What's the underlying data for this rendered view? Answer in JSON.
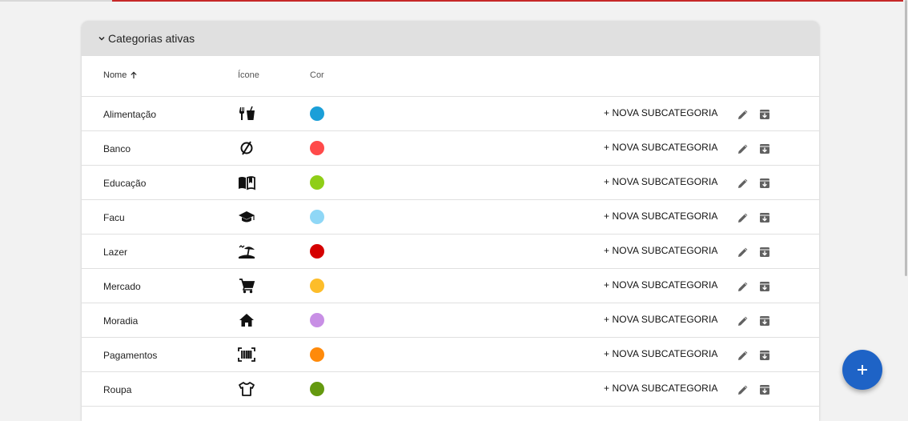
{
  "colors": {
    "accent": "#c62828",
    "fab": "#1e63c6"
  },
  "section": {
    "title": "Categorias ativas",
    "icon": "chevron-down-icon"
  },
  "table": {
    "headers": {
      "name": "Nome",
      "icon": "Ícone",
      "color": "Cor"
    },
    "sort": {
      "column": "name",
      "direction": "asc"
    },
    "action_label": "+ NOVA SUBCATEGORIA",
    "rows": [
      {
        "name": "Alimentação",
        "icon": "restaurant-icon",
        "color": "#1b9fd8"
      },
      {
        "name": "Banco",
        "icon": "empty-set-icon",
        "color": "#ff4a4a"
      },
      {
        "name": "Educação",
        "icon": "book-icon",
        "color": "#8fce17"
      },
      {
        "name": "Facu",
        "icon": "graduation-cap-icon",
        "color": "#8fd7f6"
      },
      {
        "name": "Lazer",
        "icon": "beach-icon",
        "color": "#d50000"
      },
      {
        "name": "Mercado",
        "icon": "shopping-cart-icon",
        "color": "#fdbd2a"
      },
      {
        "name": "Moradia",
        "icon": "home-icon",
        "color": "#c88fe5"
      },
      {
        "name": "Pagamentos",
        "icon": "barcode-icon",
        "color": "#ff8a0a"
      },
      {
        "name": "Roupa",
        "icon": "shirt-icon",
        "color": "#64990f"
      }
    ]
  },
  "fab": {
    "icon": "add-icon"
  }
}
